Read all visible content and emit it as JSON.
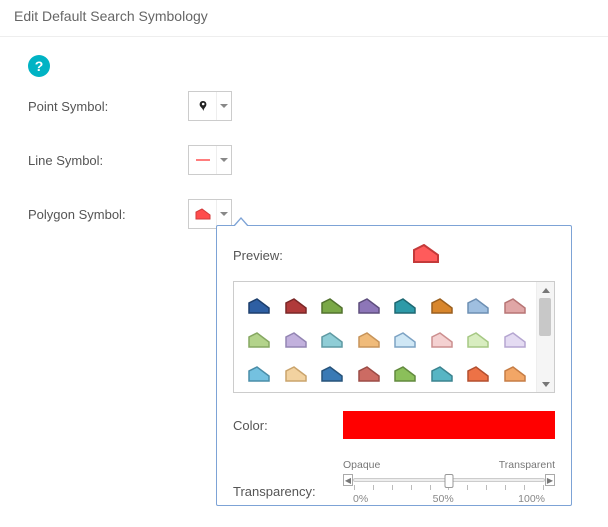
{
  "header": {
    "title": "Edit Default Search Symbology"
  },
  "help": {
    "symbol": "?"
  },
  "rows": {
    "point": {
      "label": "Point Symbol:"
    },
    "line": {
      "label": "Line Symbol:"
    },
    "poly": {
      "label": "Polygon Symbol:"
    }
  },
  "popup": {
    "preview_label": "Preview:",
    "preview_fill": "#ff5b5b",
    "preview_stroke": "#c43a3a",
    "swatches": [
      {
        "fill": "#2e5fa3",
        "stroke": "#1d3f6d"
      },
      {
        "fill": "#b03a3a",
        "stroke": "#7a2727"
      },
      {
        "fill": "#7aa847",
        "stroke": "#52722f"
      },
      {
        "fill": "#8d76b8",
        "stroke": "#5e4e7d"
      },
      {
        "fill": "#2d9aa8",
        "stroke": "#1e6872"
      },
      {
        "fill": "#d8862c",
        "stroke": "#9a5f1e"
      },
      {
        "fill": "#9fbfe0",
        "stroke": "#6d8fb3"
      },
      {
        "fill": "#e0a6a6",
        "stroke": "#b77575"
      },
      {
        "fill": "#b3d38b",
        "stroke": "#86a862"
      },
      {
        "fill": "#c2b1dd",
        "stroke": "#9385b3"
      },
      {
        "fill": "#8fcdd6",
        "stroke": "#5f9aa3"
      },
      {
        "fill": "#f0bb7a",
        "stroke": "#c7945a"
      },
      {
        "fill": "#cfe7f5",
        "stroke": "#7da3c4"
      },
      {
        "fill": "#f4d1d1",
        "stroke": "#cc8f8f"
      },
      {
        "fill": "#d8edc0",
        "stroke": "#a6c884"
      },
      {
        "fill": "#e4dbf2",
        "stroke": "#b5a6d1"
      },
      {
        "fill": "#74c1e0",
        "stroke": "#4a8da8"
      },
      {
        "fill": "#f2d2a0",
        "stroke": "#caa46c"
      },
      {
        "fill": "#3a7ab5",
        "stroke": "#27537a"
      },
      {
        "fill": "#cc6b63",
        "stroke": "#9c4c46"
      },
      {
        "fill": "#8bbf5a",
        "stroke": "#628a3e"
      },
      {
        "fill": "#57b5c4",
        "stroke": "#3b838f"
      },
      {
        "fill": "#ed7246",
        "stroke": "#b34f2f"
      },
      {
        "fill": "#f2a666",
        "stroke": "#c67d45"
      }
    ],
    "color_label": "Color:",
    "color_value": "#ff0000",
    "transparency": {
      "label": "Transparency:",
      "left": "Opaque",
      "right": "Transparent",
      "ticks": [
        "0%",
        "50%",
        "100%"
      ],
      "value_pct": 50
    }
  }
}
